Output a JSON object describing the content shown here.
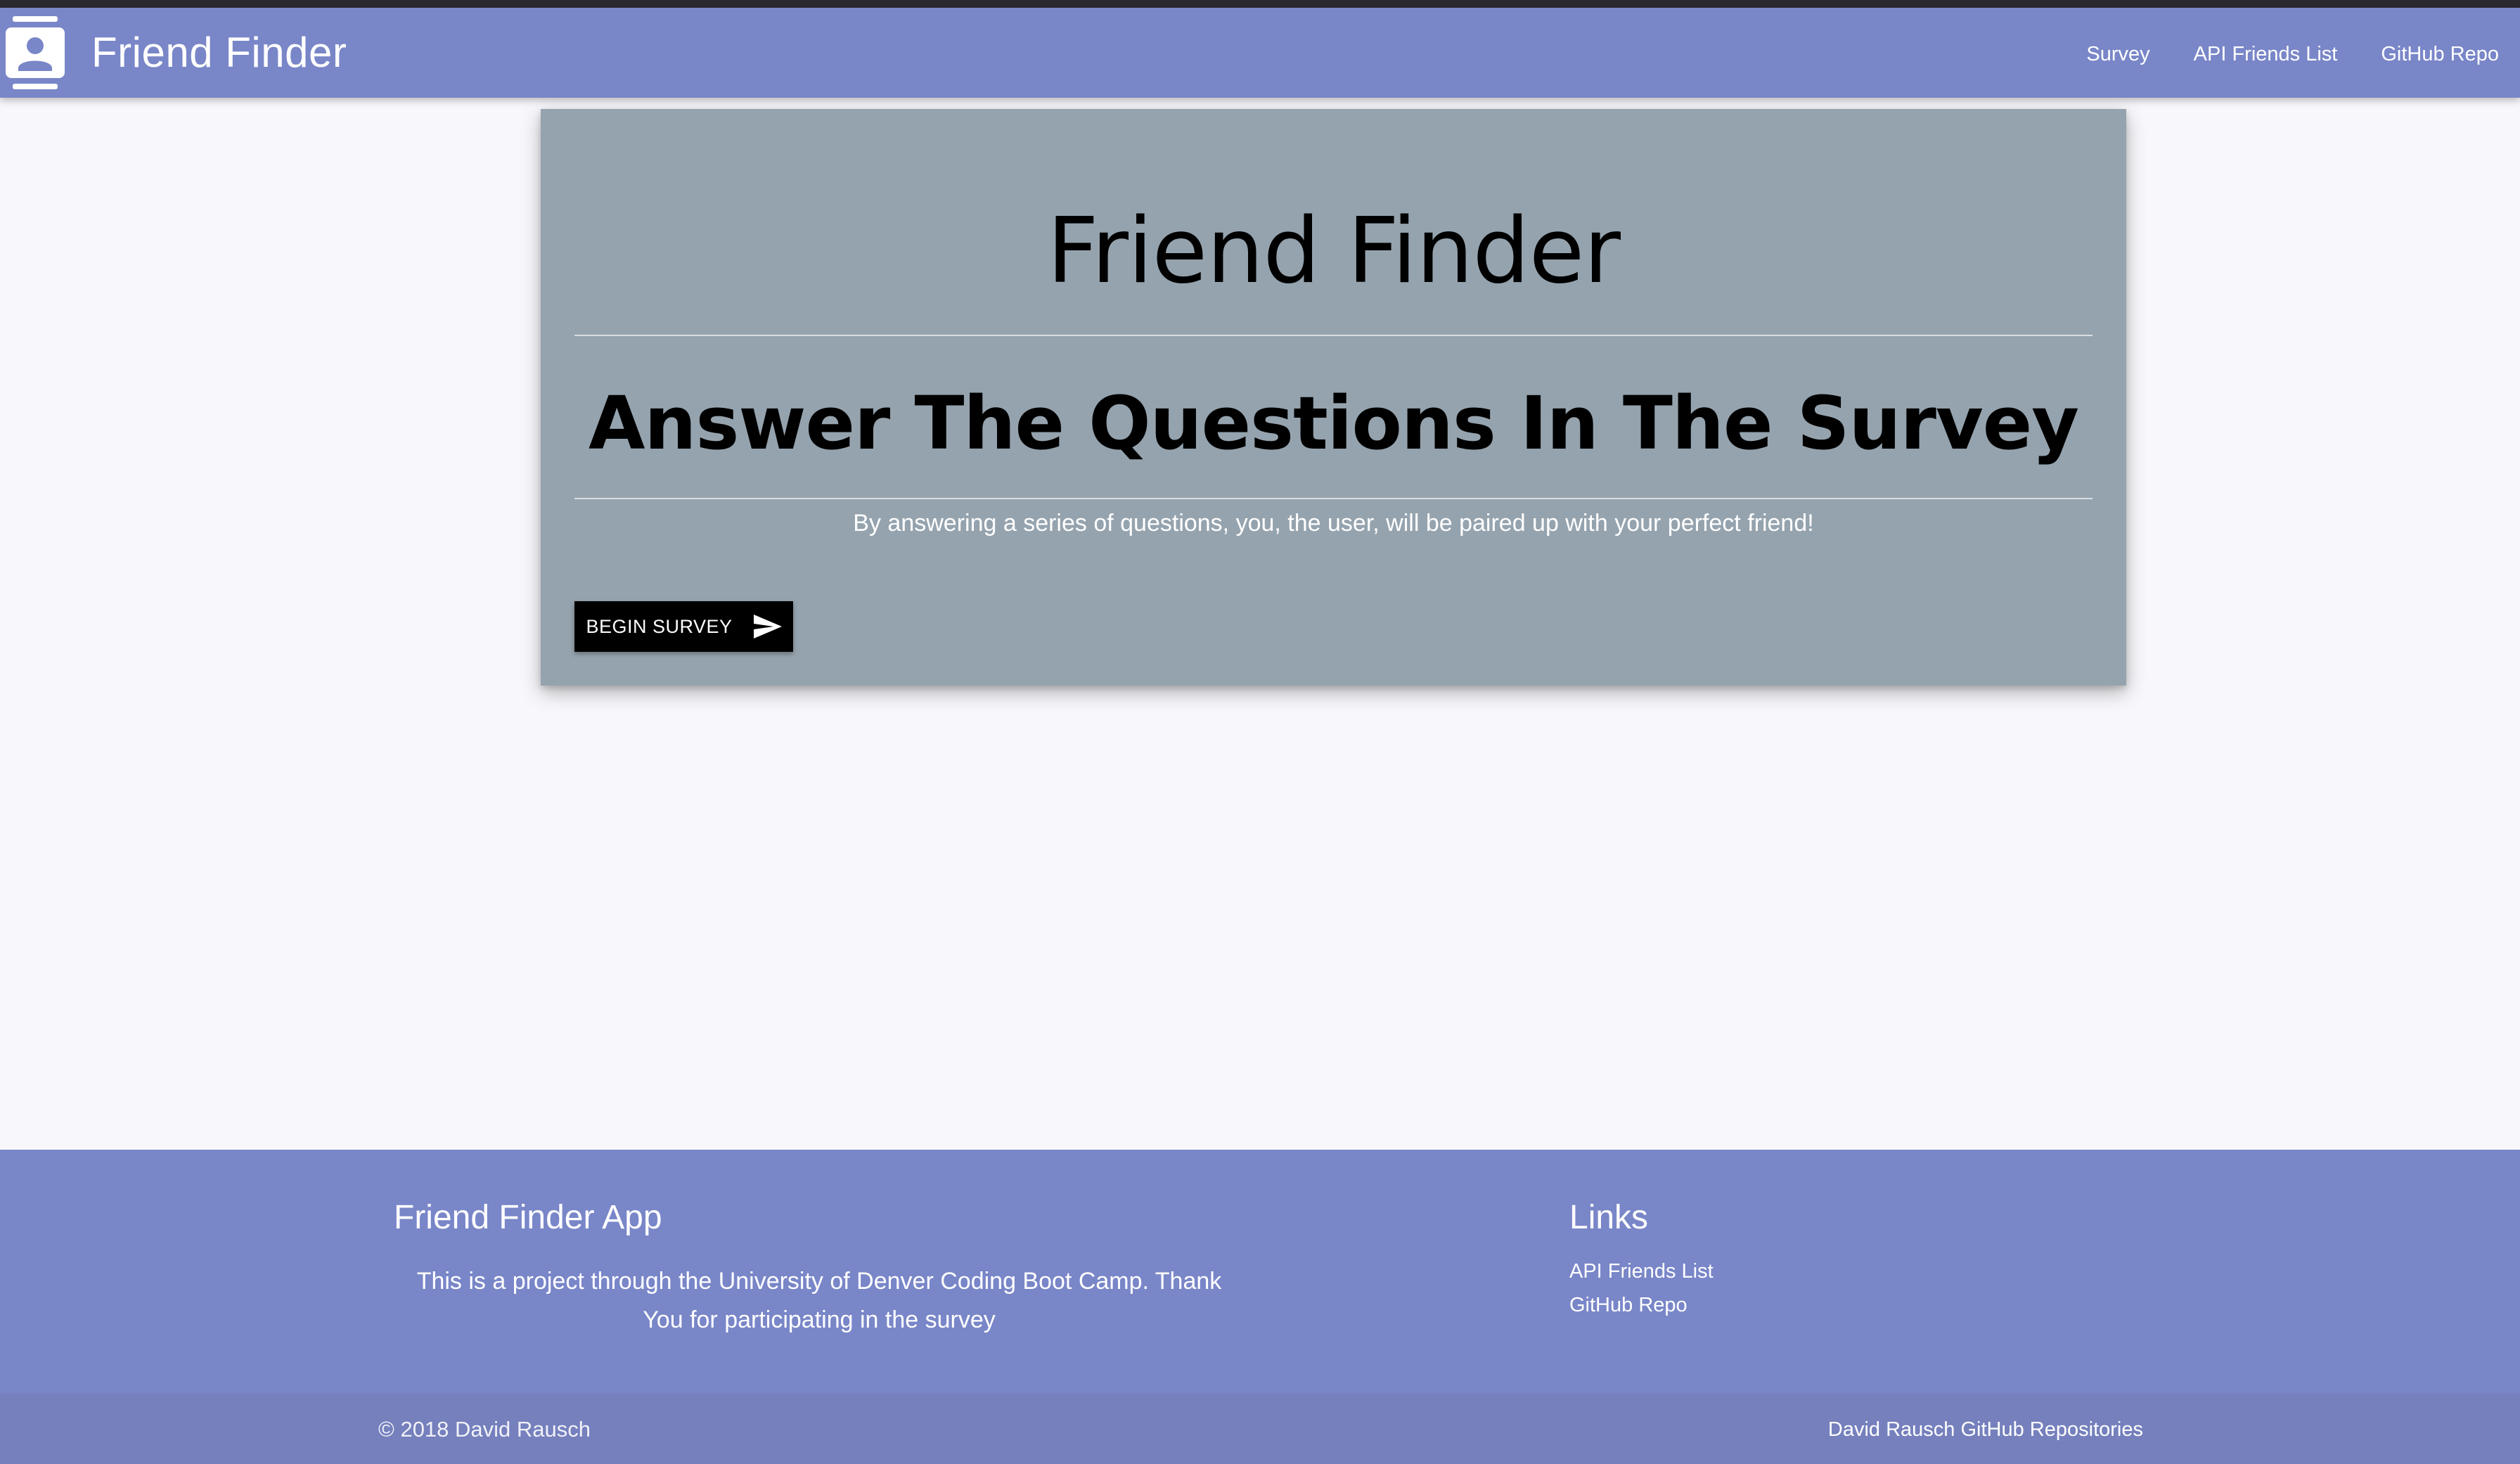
{
  "navbar": {
    "brand": "Friend Finder",
    "brand_icon": "contact-card-icon",
    "links": [
      "Survey",
      "API Friends List",
      "GitHub Repo"
    ],
    "color": "#7986c8"
  },
  "card": {
    "title": "Friend Finder",
    "subtitle": "Answer The Questions In The Survey",
    "description": "By answering a series of questions, you, the user, will be paired up with your perfect friend!",
    "button_label": "BEGIN SURVEY",
    "button_icon": "send-icon",
    "background": "#95a3ae"
  },
  "footer": {
    "heading": "Friend Finder App",
    "text": "This is a project through the University of Denver Coding Boot Camp. Thank You for participating in the survey",
    "links_heading": "Links",
    "links": [
      "API Friends List",
      "GitHub Repo"
    ],
    "copyright": "© 2018 David Rausch",
    "repos_link": "David Rausch GitHub Repositories"
  }
}
